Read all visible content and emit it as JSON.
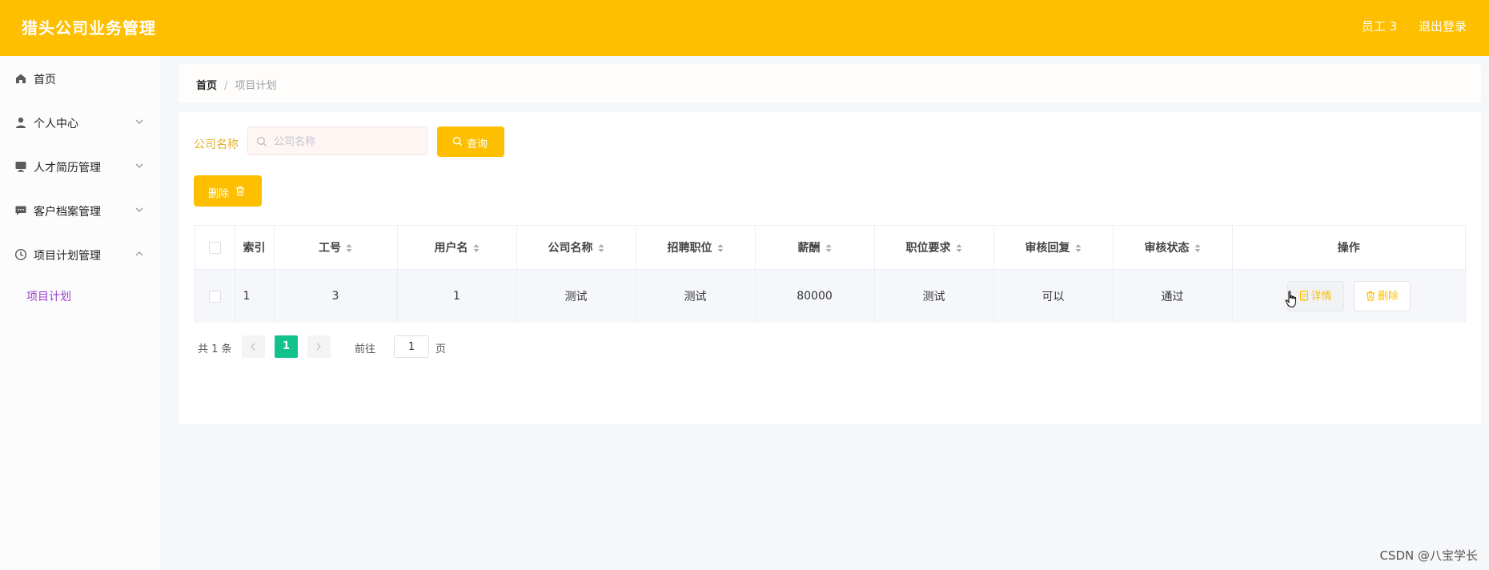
{
  "header": {
    "title": "猎头公司业务管理",
    "user": "员工 3",
    "logout": "退出登录",
    "accent_color": "#fdbf00"
  },
  "sidebar": {
    "items": [
      {
        "label": "首页",
        "icon": "home-icon"
      },
      {
        "label": "个人中心",
        "icon": "user-icon",
        "expandable": true
      },
      {
        "label": "人才简历管理",
        "icon": "monitor-icon",
        "expandable": true
      },
      {
        "label": "客户档案管理",
        "icon": "chat-icon",
        "expandable": true
      },
      {
        "label": "项目计划管理",
        "icon": "clock-icon",
        "expandable": true,
        "expanded": true
      }
    ],
    "submenu_active": "项目计划"
  },
  "breadcrumb": {
    "home": "首页",
    "separator": "/",
    "current": "项目计划"
  },
  "search": {
    "label": "公司名称",
    "placeholder": "公司名称",
    "value": "",
    "query_label": "查询"
  },
  "toolbar": {
    "delete_label": "删除"
  },
  "table": {
    "columns": [
      "索引",
      "工号",
      "用户名",
      "公司名称",
      "招聘职位",
      "薪酬",
      "职位要求",
      "审核回复",
      "审核状态",
      "操作"
    ],
    "rows": [
      {
        "index": "1",
        "employee_no": "3",
        "username": "1",
        "company": "测试",
        "position": "测试",
        "salary": "80000",
        "requirement": "测试",
        "review_reply": "可以",
        "review_status": "通过",
        "detail_label": "详情",
        "delete_label": "删除"
      }
    ]
  },
  "pagination": {
    "total": "共 1 条",
    "current_page": "1",
    "goto_label": "前往",
    "goto_value": "1",
    "page_suffix": "页"
  },
  "watermark": "CSDN @八宝学长"
}
